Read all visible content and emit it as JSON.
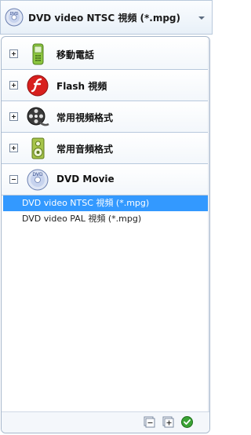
{
  "selector": {
    "title": "DVD video NTSC 視頻 (*.mpg)",
    "icon": "dvd-disc-icon",
    "arrow_icon": "chevron-down-icon"
  },
  "categories": [
    {
      "label": "移動電話",
      "icon": "mobile-phone-icon",
      "expanded": false
    },
    {
      "label": "Flash 視頻",
      "icon": "flash-icon",
      "expanded": false
    },
    {
      "label": "常用視頻格式",
      "icon": "film-reel-icon",
      "expanded": false
    },
    {
      "label": "常用音頻格式",
      "icon": "speaker-icon",
      "expanded": false
    },
    {
      "label": "DVD Movie",
      "icon": "dvd-disc-icon",
      "expanded": true
    }
  ],
  "dvd_items": [
    {
      "label": "DVD video NTSC 視頻 (*.mpg)",
      "selected": true
    },
    {
      "label": "DVD video PAL 視頻 (*.mpg)",
      "selected": false
    }
  ],
  "footer": {
    "buttons": [
      "collapse-all-icon",
      "expand-all-icon",
      "confirm-check-icon"
    ]
  },
  "colors": {
    "selection": "#3399ff",
    "border": "#a8b8cc",
    "confirm": "#3aa335"
  }
}
